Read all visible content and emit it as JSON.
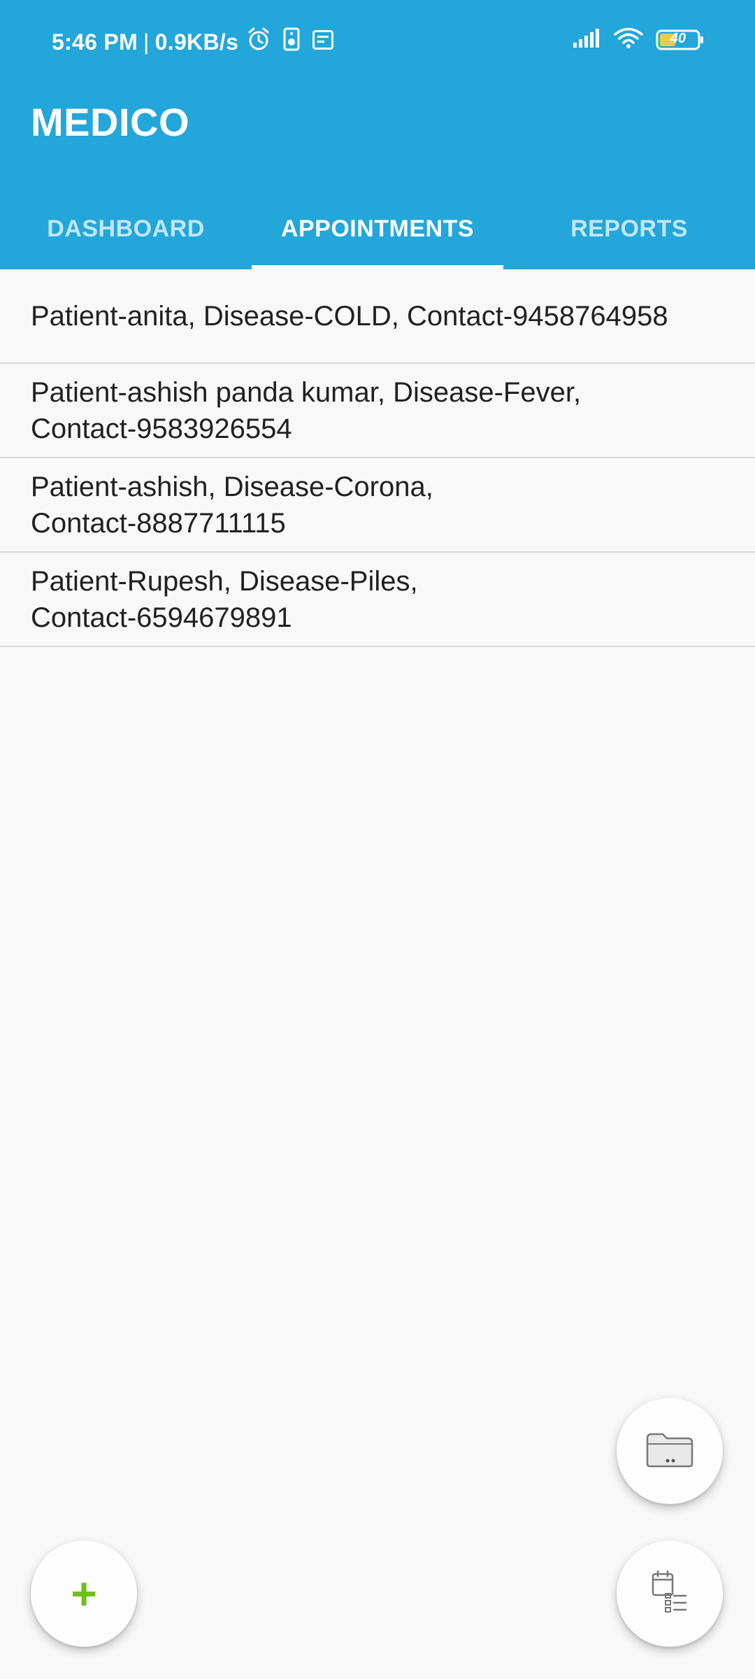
{
  "status_bar": {
    "time": "5:46 PM",
    "separator": "|",
    "net_speed": "0.9KB/s",
    "battery_level": "40",
    "icons": [
      "alarm-icon",
      "speaker-icon",
      "notes-icon",
      "signal-icon",
      "wifi-icon",
      "battery-icon"
    ]
  },
  "app": {
    "title": "MEDICO",
    "primary_color": "#23a6da"
  },
  "tabs": [
    {
      "label": "DASHBOARD",
      "active": false
    },
    {
      "label": "APPOINTMENTS",
      "active": true
    },
    {
      "label": "REPORTS",
      "active": false
    }
  ],
  "appointments": [
    {
      "text": "Patient-anita, Disease-COLD, Contact-9458764958"
    },
    {
      "text": "Patient-ashish panda kumar, Disease-Fever, Contact-9583926554"
    },
    {
      "text": "Patient-ashish, Disease-Corona, Contact-8887711115"
    },
    {
      "text": "Patient-Rupesh, Disease-Piles, Contact-6594679891"
    }
  ],
  "fabs": {
    "add_symbol": "+",
    "add_color": "#6fbf1a",
    "folder_icon": "folder-icon",
    "list_icon": "calendar-list-icon"
  }
}
